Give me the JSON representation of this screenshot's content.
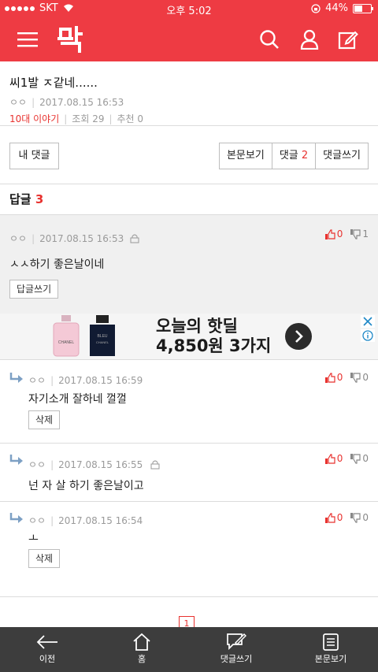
{
  "status": {
    "carrier": "SKT",
    "time": "오후 5:02",
    "battery": "44%",
    "battery_level": 0.44
  },
  "appbar": {
    "logo_text": "판"
  },
  "post": {
    "title": "씨1발 ㅈ같네......",
    "author": "ㅇㅇ",
    "date": "2017.08.15 16:53",
    "category": "10대 이야기",
    "views": "조회 29",
    "recommend": "추천 0"
  },
  "actions": {
    "my_comments": "내 댓글",
    "view_post": "본문보기",
    "comments_label": "댓글",
    "comments_count": "2",
    "write_comment": "댓글쓰기"
  },
  "replies": {
    "label": "답글",
    "count": "3"
  },
  "comments": [
    {
      "author": "ㅇㅇ",
      "date": "2017.08.15 16:53",
      "text": "ㅅㅅ하기 좋은날이네",
      "button": "답글쓰기",
      "up": "0",
      "down": "1"
    },
    {
      "author": "ㅇㅇ",
      "date": "2017.08.15 16:59",
      "text": "자기소개 잘하네 껄껄",
      "button": "삭제",
      "up": "0",
      "down": "0"
    },
    {
      "author": "ㅇㅇ",
      "date": "2017.08.15 16:55",
      "text": "넌 자 살 하기 좋은날이고",
      "up": "0",
      "down": "0"
    },
    {
      "author": "ㅇㅇ",
      "date": "2017.08.15 16:54",
      "text": "ㅗ",
      "button": "삭제",
      "up": "0",
      "down": "0"
    }
  ],
  "ad": {
    "line1": "오늘의 핫딜",
    "line2": "4,850원 3가지",
    "brand1": "CHANEL",
    "brand2": "BLEU",
    "brand3": "CHANEL"
  },
  "pagination": {
    "current": "1"
  },
  "bottom_nav": {
    "back": "이전",
    "home": "홈",
    "write": "댓글쓰기",
    "view": "본문보기"
  },
  "colors": {
    "brand": "#ee3b43",
    "accent": "#e8322f",
    "bottom_bar": "#3d3d3d"
  }
}
